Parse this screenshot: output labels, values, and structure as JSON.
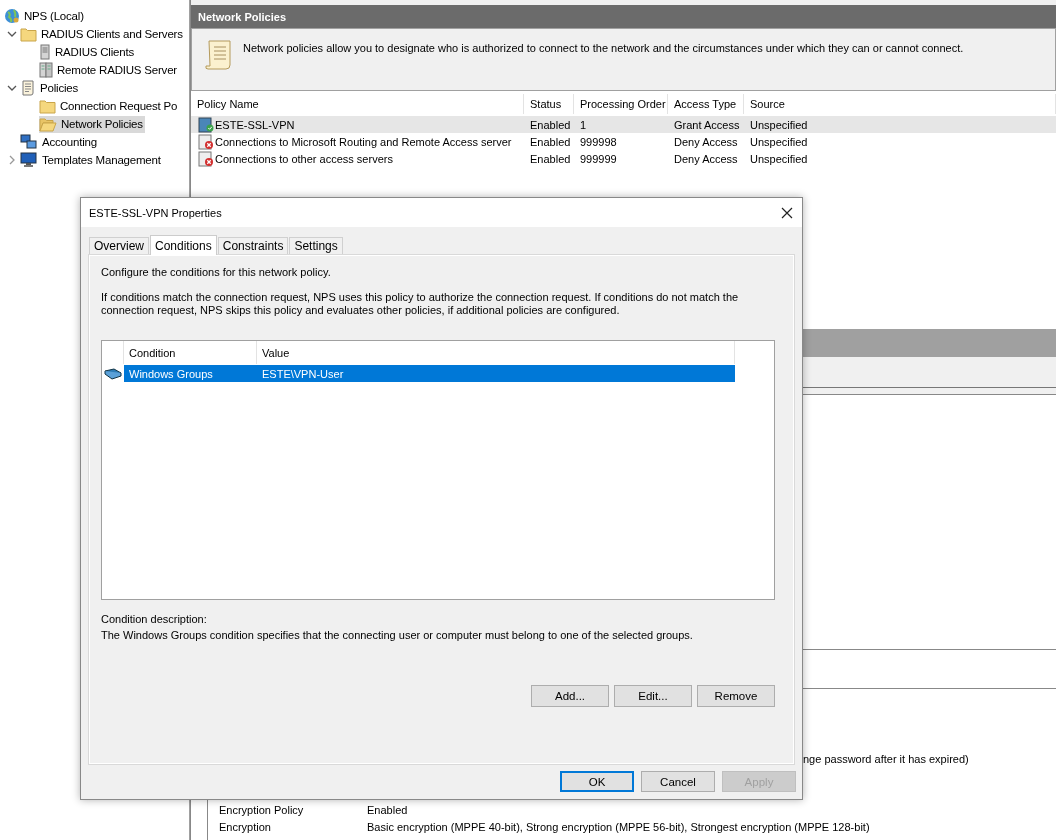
{
  "tree": [
    {
      "label": "NPS (Local)",
      "kind": "globe",
      "selected": false,
      "children": [
        {
          "label": "RADIUS Clients and Servers",
          "kind": "folder",
          "selected": false,
          "expanded": true,
          "children": [
            {
              "label": "RADIUS Clients",
              "kind": "server",
              "selected": false
            },
            {
              "label": "Remote RADIUS Server",
              "kind": "servers",
              "selected": false
            }
          ]
        },
        {
          "label": "Policies",
          "kind": "scroll",
          "selected": false,
          "expanded": true,
          "children": [
            {
              "label": "Connection Request Po",
              "kind": "folder",
              "selected": false
            },
            {
              "label": "Network Policies",
              "kind": "folder-open",
              "selected": true
            }
          ]
        },
        {
          "label": "Accounting",
          "kind": "accounting",
          "selected": false
        },
        {
          "label": "Templates Management",
          "kind": "monitor",
          "selected": false,
          "expanded": false
        }
      ]
    }
  ],
  "pane": {
    "title": "Network Policies",
    "description": "Network policies allow you to designate who is authorized to connect to the network and the circumstances under which they can or cannot connect.",
    "columns": [
      "Policy Name",
      "Status",
      "Processing Order",
      "Access Type",
      "Source"
    ],
    "rows": [
      {
        "kind": "grant",
        "selected": true,
        "cells": [
          "ESTE-SSL-VPN",
          "Enabled",
          "1",
          "Grant Access",
          "Unspecified"
        ]
      },
      {
        "kind": "deny",
        "selected": false,
        "cells": [
          "Connections to Microsoft Routing and Remote Access server",
          "Enabled",
          "999998",
          "Deny Access",
          "Unspecified"
        ]
      },
      {
        "kind": "deny",
        "selected": false,
        "cells": [
          "Connections to other access servers",
          "Enabled",
          "999999",
          "Deny Access",
          "Unspecified"
        ]
      }
    ],
    "details": [
      {
        "kind": "partial",
        "value": "nge password after it has expired)"
      },
      {
        "kind": "pair",
        "label": "Encryption Policy",
        "value": "Enabled"
      },
      {
        "kind": "pair",
        "label": "Encryption",
        "value": "Basic encryption (MPPE 40-bit), Strong encryption (MPPE 56-bit), Strongest encryption (MPPE 128-bit)"
      }
    ]
  },
  "dialog": {
    "title": "ESTE-SSL-VPN Properties",
    "tabs": [
      {
        "label": "Overview",
        "selected": false
      },
      {
        "label": "Conditions",
        "selected": true
      },
      {
        "label": "Constraints",
        "selected": false
      },
      {
        "label": "Settings",
        "selected": false
      }
    ],
    "intro": "Configure the conditions for this network policy.",
    "explanation": "If conditions match the connection request, NPS uses this policy to authorize the connection request. If conditions do not match the connection request, NPS skips this policy and evaluates other policies, if additional policies are configured.",
    "columns": [
      "Condition",
      "Value"
    ],
    "conditions": [
      {
        "selected": true,
        "condition": "Windows Groups",
        "value": "ESTE\\VPN-User"
      }
    ],
    "description_label": "Condition description:",
    "description": "The Windows Groups condition specifies that the connecting user or computer must belong to one of the selected groups.",
    "list_buttons": [
      {
        "label": "Add...",
        "disabled": false
      },
      {
        "label": "Edit...",
        "disabled": false
      },
      {
        "label": "Remove",
        "disabled": false
      }
    ],
    "buttons": [
      {
        "label": "OK",
        "default": true,
        "disabled": false
      },
      {
        "label": "Cancel",
        "default": false,
        "disabled": false
      },
      {
        "label": "Apply",
        "default": false,
        "disabled": true
      }
    ]
  }
}
